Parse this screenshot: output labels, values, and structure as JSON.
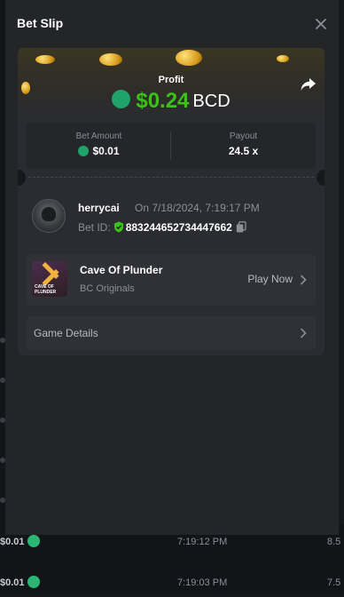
{
  "modal": {
    "title": "Bet Slip"
  },
  "hero": {
    "profit_label": "Profit",
    "profit_value": "$0.24",
    "profit_unit": "BCD"
  },
  "stats": {
    "bet_amount_label": "Bet Amount",
    "bet_amount_value": "$0.01",
    "payout_label": "Payout",
    "payout_value": "24.5 x"
  },
  "user": {
    "name": "herrycai",
    "time": "On 7/18/2024, 7:19:17 PM",
    "bet_id_label": "Bet ID:",
    "bet_id_value": "883244652734447662"
  },
  "game": {
    "name": "Cave Of Plunder",
    "provider": "BC Originals",
    "play_label": "Play Now",
    "thumb_text": "CAVE OF\nPLUNDER"
  },
  "details": {
    "label": "Game Details"
  },
  "background_rows": [
    {
      "amount": "$0.01",
      "time": "7:19:12 PM",
      "payout": "8.5"
    },
    {
      "amount": "$0.01",
      "time": "7:19:03 PM",
      "payout": "7.5"
    }
  ],
  "colors": {
    "profit_green": "#3bc117",
    "accent_currency": "#1fa36a",
    "modal_bg": "#232529"
  }
}
